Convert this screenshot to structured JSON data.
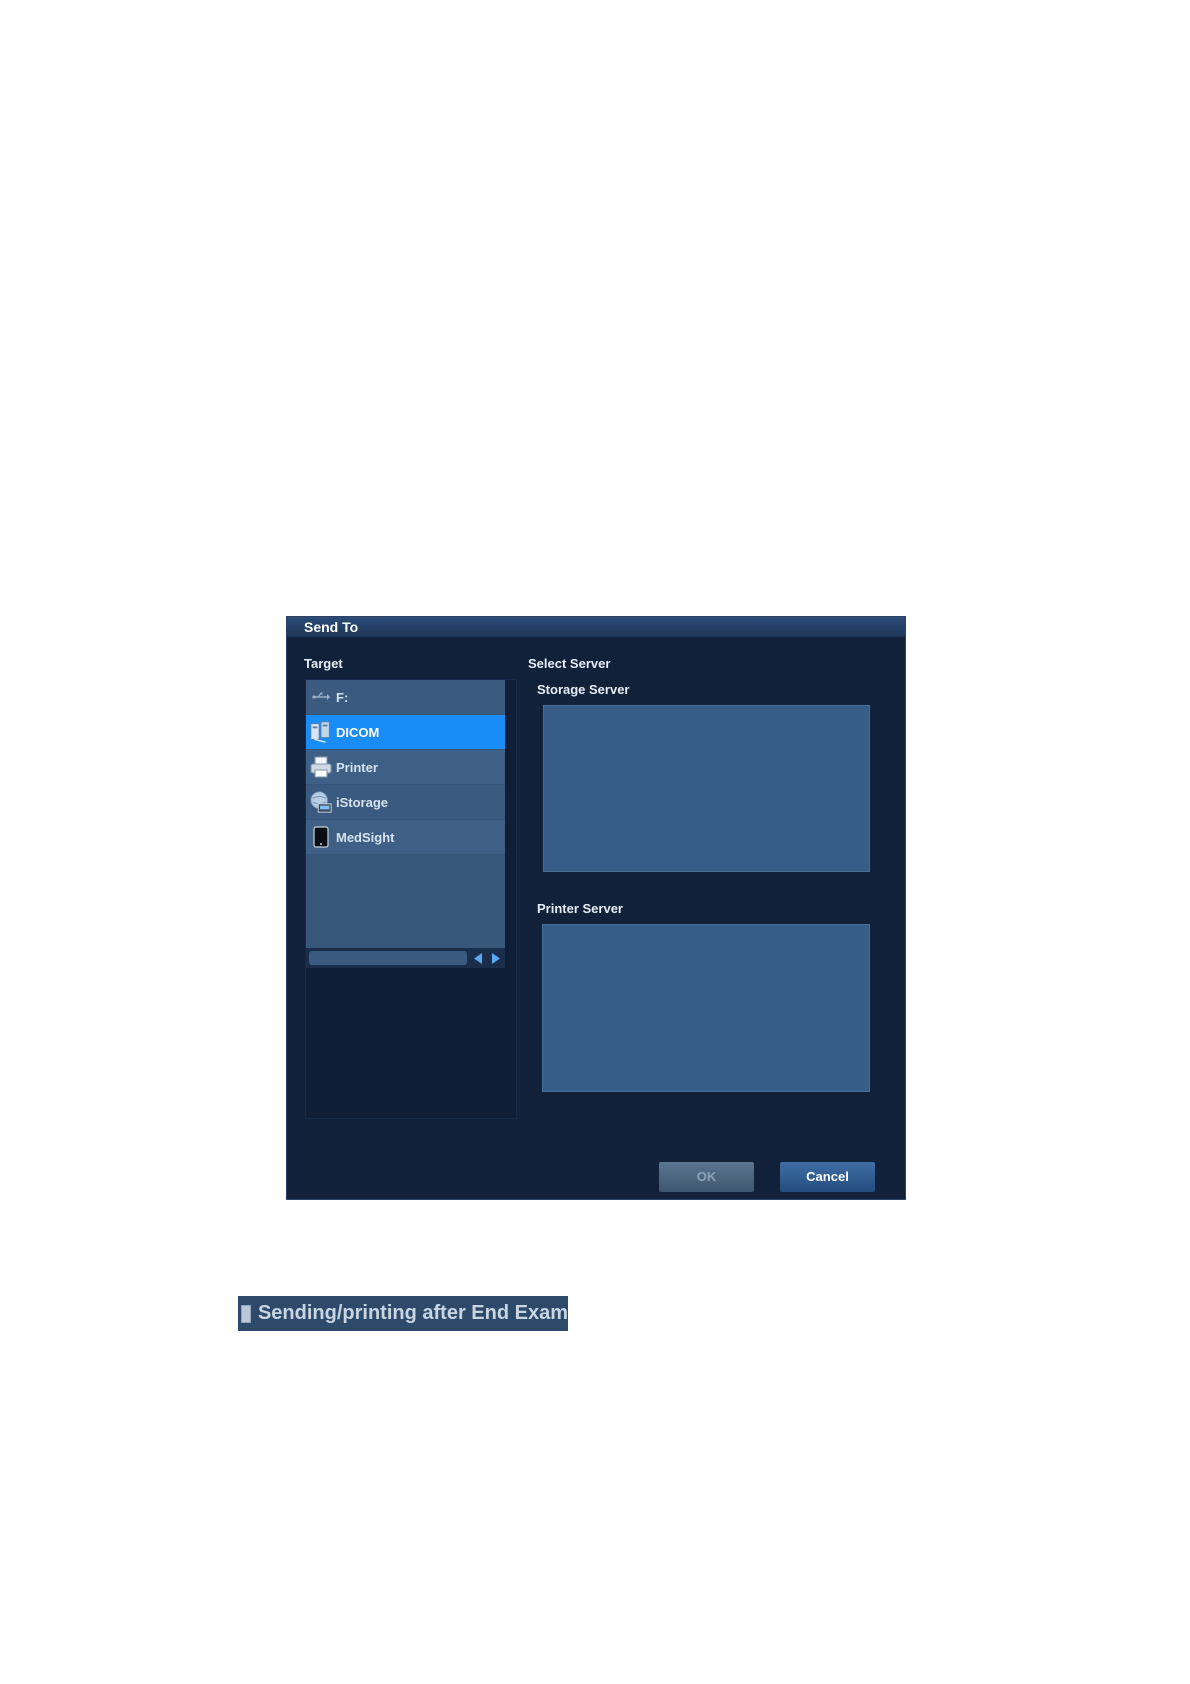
{
  "dialog": {
    "title": "Send To",
    "target_label": "Target",
    "select_server_label": "Select Server",
    "storage_server_label": "Storage Server",
    "printer_server_label": "Printer Server",
    "targets": [
      {
        "label": "F:",
        "icon": "usb-icon",
        "selected": false
      },
      {
        "label": "DICOM",
        "icon": "dicom-network-icon",
        "selected": true
      },
      {
        "label": "Printer",
        "icon": "printer-icon",
        "selected": false
      },
      {
        "label": "iStorage",
        "icon": "istorage-icon",
        "selected": false
      },
      {
        "label": "MedSight",
        "icon": "tablet-icon",
        "selected": false
      }
    ],
    "ok_label": "OK",
    "cancel_label": "Cancel"
  },
  "option": {
    "checkbox_label": "Sending/printing after End Exam",
    "checked": false
  },
  "colors": {
    "dialog_bg": "#11213a",
    "list_bg": "#365779",
    "selected_item": "#1a8cf8",
    "server_box": "#355d88"
  }
}
